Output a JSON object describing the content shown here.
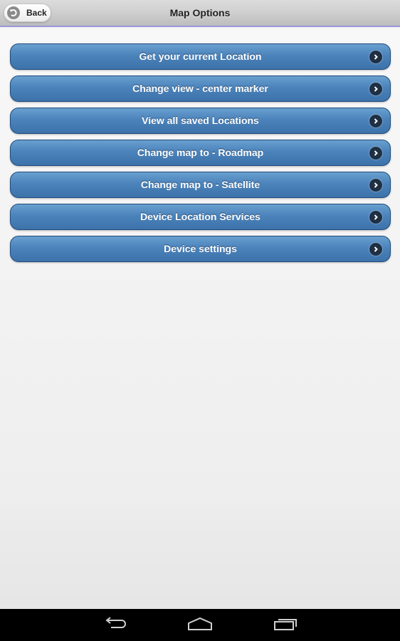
{
  "header": {
    "title": "Map Options",
    "back_label": "Back",
    "back_icon": "back-arrow-icon"
  },
  "menu": {
    "items": [
      {
        "label": "Get your current Location",
        "icon": "chevron-right-icon"
      },
      {
        "label": "Change view - center marker",
        "icon": "chevron-right-icon"
      },
      {
        "label": "View all saved Locations",
        "icon": "chevron-right-icon"
      },
      {
        "label": "Change map to - Roadmap",
        "icon": "chevron-right-icon"
      },
      {
        "label": "Change map to - Satellite",
        "icon": "chevron-right-icon"
      },
      {
        "label": "Device Location Services",
        "icon": "chevron-right-icon"
      },
      {
        "label": "Device settings",
        "icon": "chevron-right-icon"
      }
    ]
  },
  "navbar": {
    "buttons": [
      {
        "name": "back",
        "icon": "nav-back-icon"
      },
      {
        "name": "home",
        "icon": "nav-home-icon"
      },
      {
        "name": "recent-apps",
        "icon": "nav-recents-icon"
      }
    ]
  },
  "colors": {
    "button_blue": "#4b83bb",
    "header_border": "#9b96d8",
    "chevron_bg": "#1f2f44"
  }
}
